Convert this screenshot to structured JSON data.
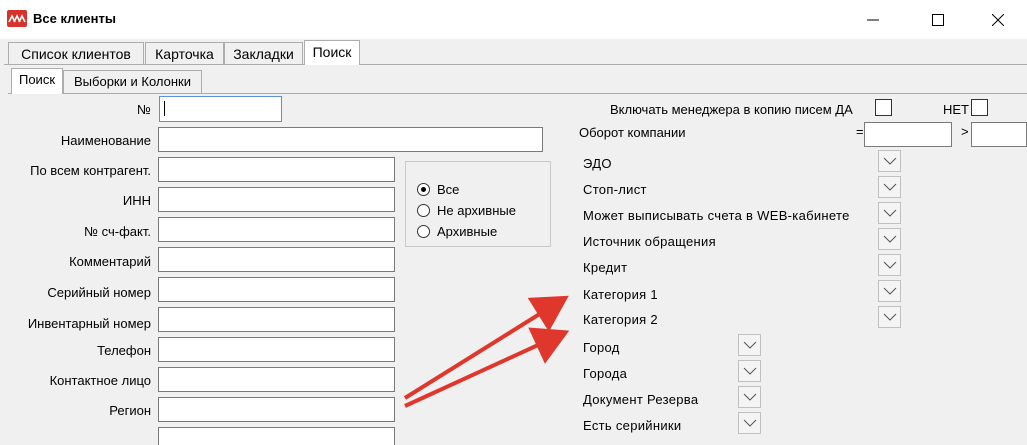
{
  "window": {
    "title": "Все клиенты",
    "icon": "app-logo-icon",
    "controls": [
      "minimize-icon",
      "maximize-icon",
      "close-icon"
    ]
  },
  "tabs": [
    {
      "label": "Список клиентов",
      "active": false
    },
    {
      "label": "Карточка",
      "active": false
    },
    {
      "label": "Закладки",
      "active": false
    },
    {
      "label": "Поиск",
      "active": true
    }
  ],
  "subtabs": [
    {
      "label": "Поиск",
      "active": true
    },
    {
      "label": "Выборки и Колонки",
      "active": false
    }
  ],
  "form": {
    "fields": [
      {
        "label": "№",
        "value": ""
      },
      {
        "label": "Наименование",
        "value": ""
      },
      {
        "label": "По всем контрагент.",
        "value": ""
      },
      {
        "label": "ИНН",
        "value": ""
      },
      {
        "label": "№ сч-факт.",
        "value": ""
      },
      {
        "label": "Комментарий",
        "value": ""
      },
      {
        "label": "Серийный номер",
        "value": ""
      },
      {
        "label": "Инвентарный номер",
        "value": ""
      },
      {
        "label": "Телефон",
        "value": ""
      },
      {
        "label": "Контактное лицо",
        "value": ""
      },
      {
        "label": "Регион",
        "value": ""
      }
    ],
    "archive_filter": {
      "options": [
        "Все",
        "Не архивные",
        "Архивные"
      ],
      "selected": "Все"
    }
  },
  "right": {
    "include_manager": {
      "label": "Включать менеджера в копию писем ДА",
      "no_label": "НЕТ"
    },
    "turnover": {
      "label": "Оборот компании",
      "eq": "=",
      "gt": ">",
      "eq_value": "",
      "gt_value": ""
    },
    "filters": [
      {
        "label": "ЭДО"
      },
      {
        "label": "Стоп-лист"
      },
      {
        "label": "Может выписывать счета в WEB-кабинете"
      },
      {
        "label": "Источник обращения"
      },
      {
        "label": "Кредит"
      },
      {
        "label": "Категория 1"
      },
      {
        "label": "Категория 2"
      },
      {
        "label": "Город"
      },
      {
        "label": "Города"
      },
      {
        "label": "Документ Резерва"
      },
      {
        "label": "Есть серийники"
      }
    ]
  },
  "annotation": {
    "color": "#e0372d",
    "type": "red-arrows",
    "targets": [
      "Категория 1",
      "Категория 2"
    ]
  }
}
